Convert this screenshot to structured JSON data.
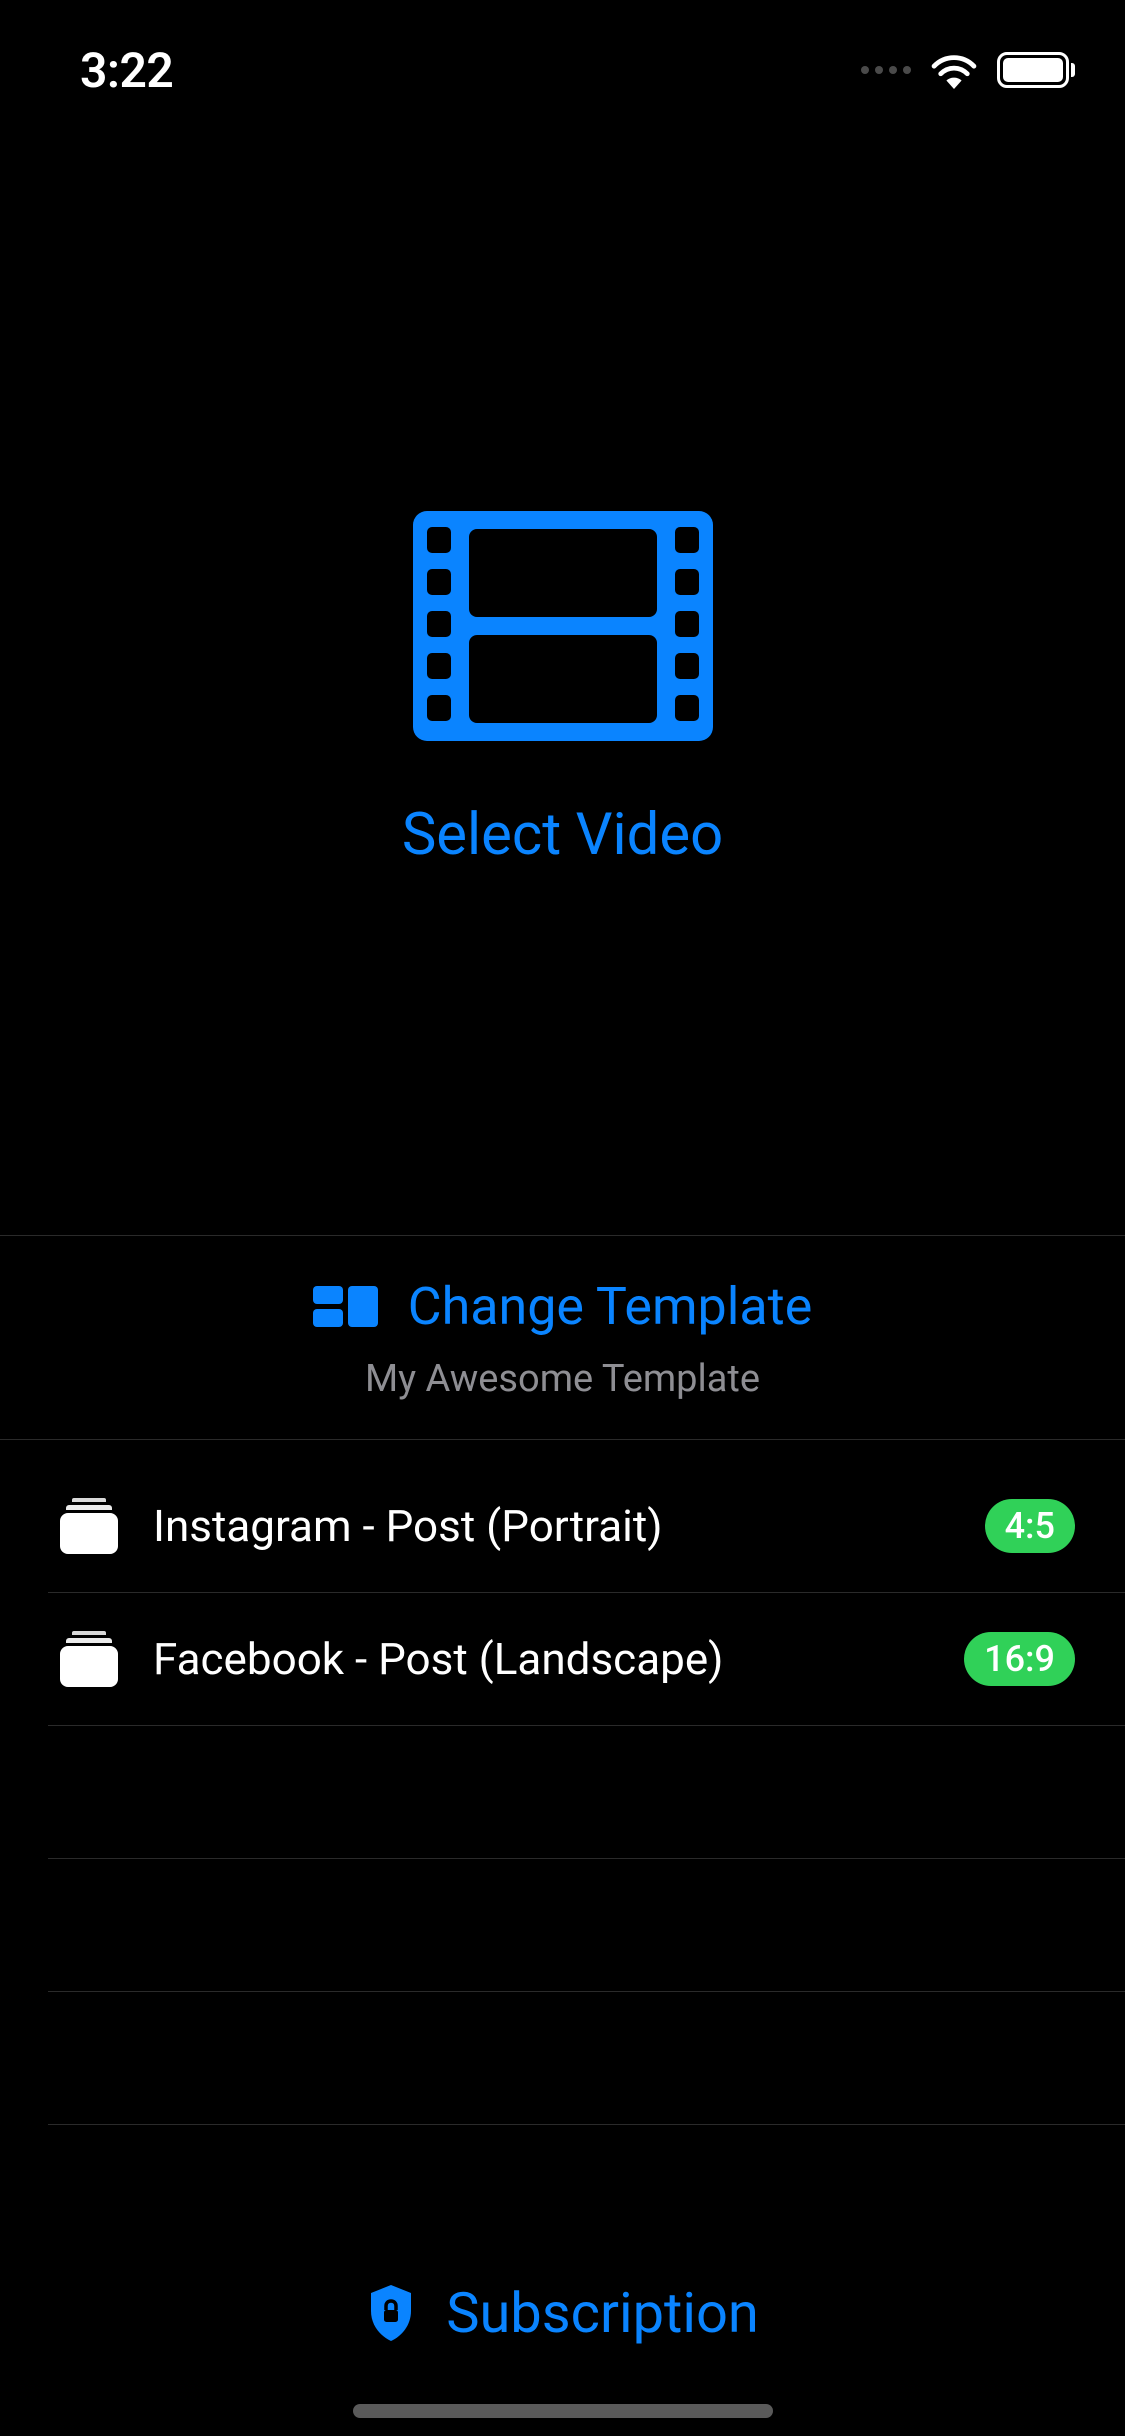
{
  "status": {
    "time": "3:22"
  },
  "select_video": {
    "label": "Select Video"
  },
  "template_section": {
    "change_label": "Change Template",
    "current_name": "My Awesome Template"
  },
  "list": {
    "items": [
      {
        "label": "Instagram - Post (Portrait)",
        "ratio": "4:5"
      },
      {
        "label": "Facebook - Post (Landscape)",
        "ratio": "16:9"
      }
    ]
  },
  "subscription": {
    "label": "Subscription"
  },
  "colors": {
    "accent": "#0a84ff",
    "badge": "#30d158"
  }
}
